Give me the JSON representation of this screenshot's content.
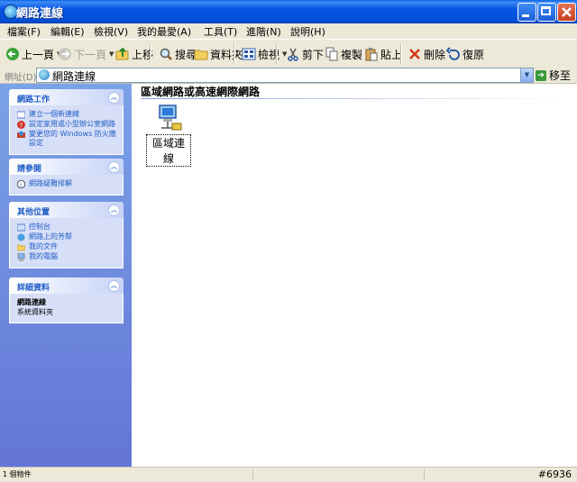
{
  "window": {
    "title": "網路連線"
  },
  "menu": [
    "檔案(F)",
    "編輯(E)",
    "檢視(V)",
    "我的最愛(A)",
    "工具(T)",
    "進階(N)",
    "說明(H)"
  ],
  "toolbar": {
    "back": "上一頁",
    "forward": "下一頁",
    "up": "上移",
    "search": "搜尋",
    "folders": "資料夾",
    "views": "檢視",
    "cut": "剪下",
    "copy": "複製",
    "paste": "貼上",
    "delete": "刪除",
    "undo": "復原"
  },
  "address": {
    "label": "網址(D)",
    "value": "網路連線",
    "go": "移至"
  },
  "sidebar": {
    "network_tasks": {
      "title": "網路工作",
      "items": [
        "建立一個新連線",
        "設定家用或小型辦公室網路",
        "變更您的 Windows 防火牆設定"
      ]
    },
    "see_also": {
      "title": "請參閱",
      "items": [
        "網路疑難排解"
      ]
    },
    "other_places": {
      "title": "其他位置",
      "items": [
        "控制台",
        "網路上的芳鄰",
        "我的文件",
        "我的電腦"
      ]
    },
    "details": {
      "title": "詳細資料",
      "name": "網路連線",
      "sub": "系統資料夾"
    }
  },
  "content": {
    "group_header": "區域網路或高速網際網路",
    "items": [
      {
        "label": "區域連線"
      }
    ]
  },
  "status": {
    "text": "1 個物件",
    "id": "#6936"
  },
  "colors": {
    "title_bar": "#0554e3",
    "sidebar": "#7ba2e7",
    "link": "#215dc6",
    "chrome": "#ece9d8"
  }
}
